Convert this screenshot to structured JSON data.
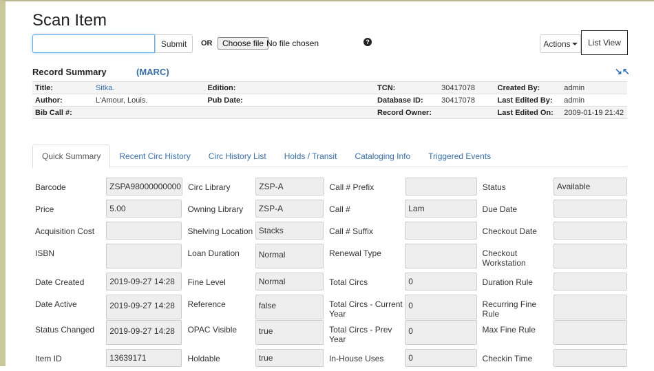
{
  "page_title": "Scan Item",
  "scan": {
    "input_value": "",
    "submit_label": "Submit",
    "or_label": "OR",
    "choose_file_label": "Choose file",
    "no_file_text": "No file chosen",
    "help_icon": "question-circle-icon"
  },
  "toolbar": {
    "actions_label": "Actions",
    "list_view_label": "List View"
  },
  "record_summary": {
    "heading": "Record Summary",
    "marc_label": "(MARC)",
    "collapse_icon": "collapse-arrows-icon",
    "rows": [
      [
        {
          "label": "Title:",
          "value": "Sitka.",
          "link": true
        },
        {
          "label": "Edition:",
          "value": ""
        },
        {
          "label": "TCN:",
          "value": "30417078"
        },
        {
          "label": "Created By:",
          "value": "admin"
        }
      ],
      [
        {
          "label": "Author:",
          "value": "L'Amour, Louis."
        },
        {
          "label": "Pub Date:",
          "value": ""
        },
        {
          "label": "Database ID:",
          "value": "30417078"
        },
        {
          "label": "Last Edited By:",
          "value": "admin"
        }
      ],
      [
        {
          "label": "Bib Call #:",
          "value": ""
        },
        {
          "label": "",
          "value": ""
        },
        {
          "label": "Record Owner:",
          "value": ""
        },
        {
          "label": "Last Edited On:",
          "value": "2009-01-19 21:42"
        }
      ]
    ]
  },
  "tabs": [
    {
      "label": "Quick Summary",
      "active": true
    },
    {
      "label": "Recent Circ History",
      "active": false
    },
    {
      "label": "Circ History List",
      "active": false
    },
    {
      "label": "Holds / Transit",
      "active": false
    },
    {
      "label": "Cataloging Info",
      "active": false
    },
    {
      "label": "Triggered Events",
      "active": false
    }
  ],
  "quick_summary": [
    [
      {
        "label": "Barcode",
        "value": "ZSPA98000000000"
      },
      {
        "label": "Circ Library",
        "value": "ZSP-A"
      },
      {
        "label": "Call # Prefix",
        "value": ""
      },
      {
        "label": "Status",
        "value": "Available"
      }
    ],
    [
      {
        "label": "Price",
        "value": "5.00"
      },
      {
        "label": "Owning Library",
        "value": "ZSP-A"
      },
      {
        "label": "Call #",
        "value": "Lam"
      },
      {
        "label": "Due Date",
        "value": ""
      }
    ],
    [
      {
        "label": "Acquisition Cost",
        "value": ""
      },
      {
        "label": "Shelving Location",
        "value": "Stacks"
      },
      {
        "label": "Call # Suffix",
        "value": ""
      },
      {
        "label": "Checkout Date",
        "value": ""
      }
    ],
    [
      {
        "label": "ISBN",
        "value": ""
      },
      {
        "label": "Loan Duration",
        "value": "Normal"
      },
      {
        "label": "Renewal Type",
        "value": ""
      },
      {
        "label": "Checkout Workstation",
        "value": ""
      }
    ],
    [
      {
        "label": "Date Created",
        "value": "2019-09-27 14:28"
      },
      {
        "label": "Fine Level",
        "value": "Normal"
      },
      {
        "label": "Total Circs",
        "value": "0"
      },
      {
        "label": "Duration Rule",
        "value": ""
      }
    ],
    [
      {
        "label": "Date Active",
        "value": "2019-09-27 14:28"
      },
      {
        "label": "Reference",
        "value": "false"
      },
      {
        "label": "Total Circs - Current Year",
        "value": "0"
      },
      {
        "label": "Recurring Fine Rule",
        "value": ""
      }
    ],
    [
      {
        "label": "Status Changed",
        "value": "2019-09-27 14:28"
      },
      {
        "label": "OPAC Visible",
        "value": "true"
      },
      {
        "label": "Total Circs - Prev Year",
        "value": "0"
      },
      {
        "label": "Max Fine Rule",
        "value": ""
      }
    ],
    [
      {
        "label": "Item ID",
        "value": "13639171"
      },
      {
        "label": "Holdable",
        "value": "true"
      },
      {
        "label": "In-House Uses",
        "value": "0"
      },
      {
        "label": "Checkin Time",
        "value": ""
      }
    ]
  ]
}
